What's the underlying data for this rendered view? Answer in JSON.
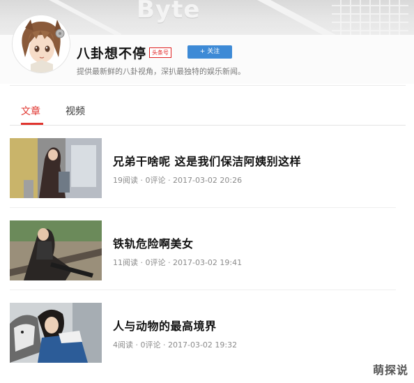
{
  "banner": {
    "logo_text": "Byte"
  },
  "profile": {
    "name": "八卦想不停",
    "badge": "头条号",
    "follow_label": "+ 关注",
    "description": "提供最新鲜的八卦视角，深扒最独特的娱乐新闻。"
  },
  "tabs": [
    {
      "label": "文章",
      "active": true
    },
    {
      "label": "视频",
      "active": false
    }
  ],
  "articles": [
    {
      "title": "兄弟干啥呢 这是我们保洁阿姨别这样",
      "reads": "19阅读",
      "comments": "0评论",
      "date": "2017-03-02 20:26"
    },
    {
      "title": "铁轨危险啊美女",
      "reads": "11阅读",
      "comments": "0评论",
      "date": "2017-03-02 19:41"
    },
    {
      "title": "人与动物的最高境界",
      "reads": "4阅读",
      "comments": "0评论",
      "date": "2017-03-02 19:32"
    }
  ],
  "meta_separator": " · ",
  "watermark": "萌探说",
  "colors": {
    "accent": "#e0352f",
    "follow": "#3d8ad6"
  }
}
